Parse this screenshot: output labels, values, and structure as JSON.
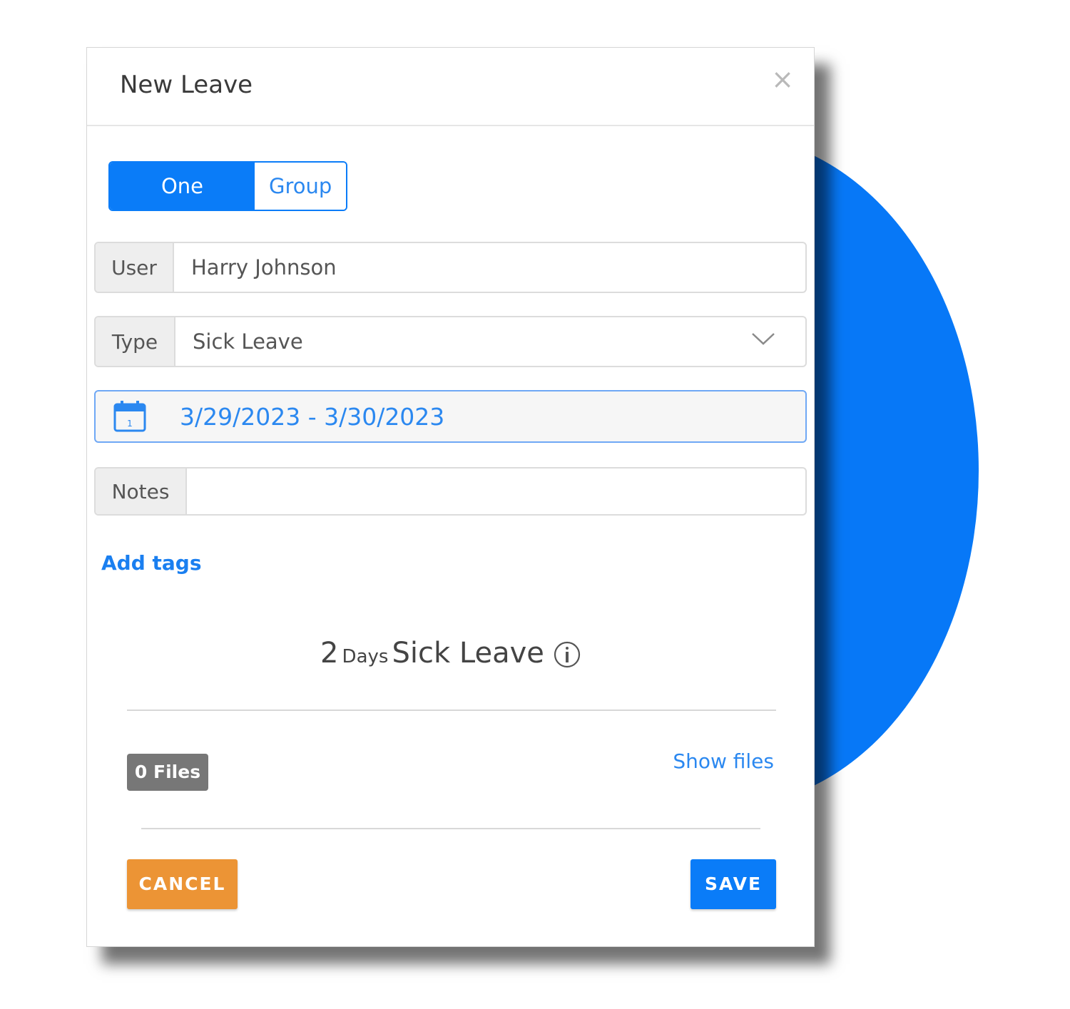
{
  "dialog": {
    "title": "New Leave",
    "close_label": "×"
  },
  "mode_toggle": {
    "one_person": "One person",
    "group": "Group",
    "selected": "One person"
  },
  "user_field": {
    "label": "User",
    "value": "Harry Johnson"
  },
  "type_field": {
    "label": "Type",
    "value": "Sick Leave"
  },
  "date_range": {
    "value": "3/29/2023 - 3/30/2023",
    "calendar_day": "1"
  },
  "notes_field": {
    "label": "Notes",
    "value": ""
  },
  "tags": {
    "add_label": "Add tags"
  },
  "summary": {
    "count": "2",
    "unit": "Days",
    "leave_type": "Sick Leave"
  },
  "files": {
    "badge": "0 Files",
    "show_label": "Show files"
  },
  "actions": {
    "cancel": "CANCEL",
    "save": "SAVE"
  },
  "colors": {
    "accent_blue": "#0a7cf8",
    "cancel_orange": "#ec9435",
    "badge_gray": "#777777"
  },
  "icons": {
    "close": "close-icon",
    "dropdown": "chevron-down-icon",
    "calendar": "calendar-icon",
    "info": "info-icon"
  }
}
